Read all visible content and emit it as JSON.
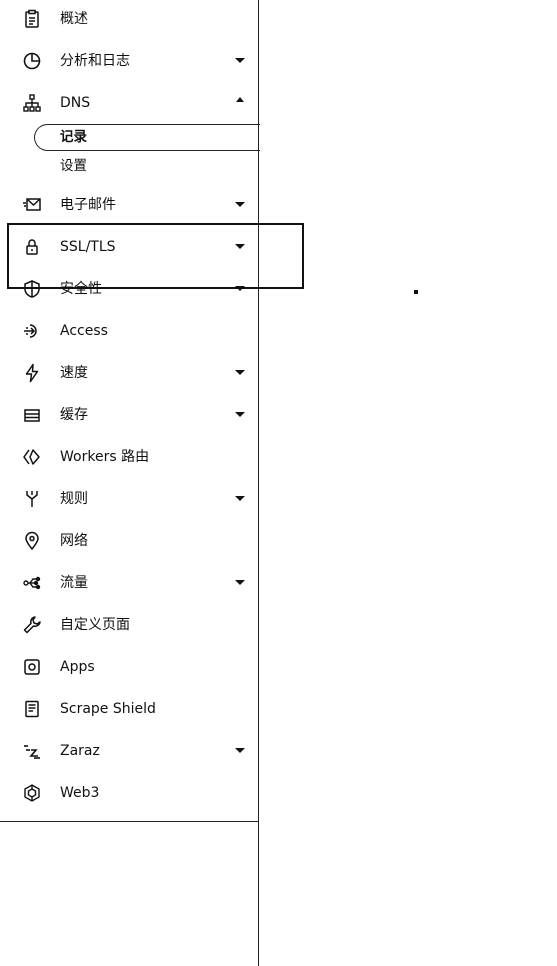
{
  "sidebar": {
    "items": [
      {
        "label": "概述",
        "icon": "clipboard-icon"
      },
      {
        "label": "分析和日志",
        "icon": "pie-chart-icon"
      },
      {
        "label": "DNS",
        "icon": "sitemap-icon"
      },
      {
        "label": "电子邮件",
        "icon": "email-icon"
      },
      {
        "label": "SSL/TLS",
        "icon": "lock-icon"
      },
      {
        "label": "安全性",
        "icon": "shield-icon"
      },
      {
        "label": "Access",
        "icon": "access-icon"
      },
      {
        "label": "速度",
        "icon": "lightning-icon"
      },
      {
        "label": "缓存",
        "icon": "cache-drive-icon"
      },
      {
        "label": "Workers 路由",
        "icon": "workers-icon"
      },
      {
        "label": "规则",
        "icon": "rules-fork-icon"
      },
      {
        "label": "网络",
        "icon": "location-pin-icon"
      },
      {
        "label": "流量",
        "icon": "traffic-icon"
      },
      {
        "label": "自定义页面",
        "icon": "wrench-icon"
      },
      {
        "label": "Apps",
        "icon": "apps-icon"
      },
      {
        "label": "Scrape Shield",
        "icon": "document-icon"
      },
      {
        "label": "Zaraz",
        "icon": "zaraz-icon"
      },
      {
        "label": "Web3",
        "icon": "web3-icon"
      }
    ],
    "dns_subitems": [
      {
        "label": "记录",
        "active": true
      },
      {
        "label": "设置",
        "active": false
      }
    ]
  }
}
